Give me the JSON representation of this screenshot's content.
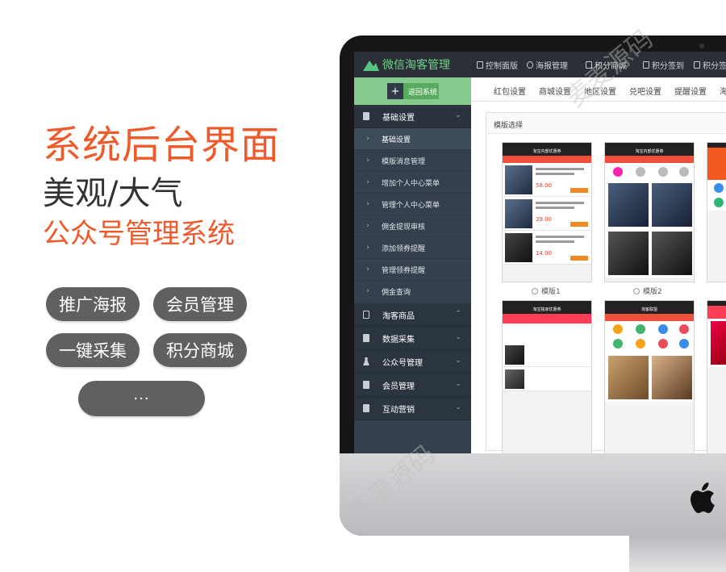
{
  "promo": {
    "title": "系统后台界面",
    "subtitle": "美观/大气",
    "tagline": "公众号管理系统",
    "pills": [
      "推广海报",
      "会员管理",
      "一键采集",
      "积分商城",
      "···"
    ]
  },
  "app": {
    "name": "微信淘客管理",
    "top_nav": [
      "控制面版",
      "海报管理",
      "积分商城",
      "积分签到"
    ],
    "back_button": "返回系统",
    "sidebar": {
      "groups": [
        {
          "label": "基础设置",
          "expanded": true
        },
        {
          "label": "淘客商品"
        },
        {
          "label": "数据采集"
        },
        {
          "label": "公众号管理"
        },
        {
          "label": "会员管理"
        },
        {
          "label": "互动营销"
        }
      ],
      "items": [
        "基础设置",
        "模版消息管理",
        "增加个人中心菜单",
        "管理个人中心菜单",
        "佣金提现审核",
        "添加领券提醒",
        "管理领券提醒",
        "佣金查询"
      ]
    },
    "sub_tabs": [
      "红包设置",
      "商城设置",
      "地区设置",
      "兑吧设置",
      "提醒设置",
      "海"
    ],
    "panel_title": "模版选择",
    "templates": [
      "模版1",
      "模版2"
    ],
    "phone_headers": [
      "淘宝内部优惠券",
      "淘宝内部优惠券",
      "淘宝独家优惠券",
      "淘客联盟"
    ],
    "sample_prices": [
      "58.00",
      "39.00",
      "14.00"
    ]
  },
  "watermark": "麦麦源码",
  "colors": {
    "accent_orange": "#ef5a2b",
    "logo_green": "#6ed08a",
    "sidebar_bg": "#34404e",
    "pill_bg": "#606060"
  }
}
